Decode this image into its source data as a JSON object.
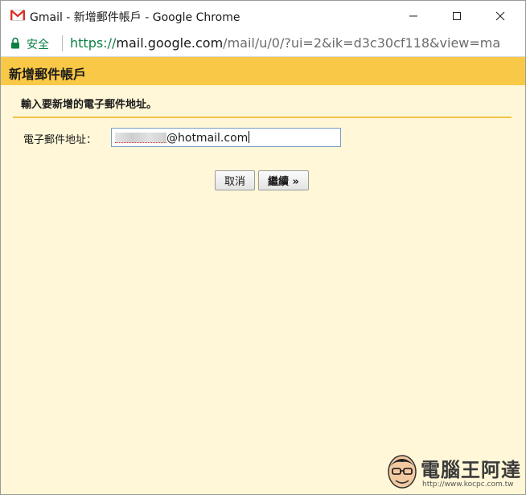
{
  "window": {
    "title": "Gmail - 新增郵件帳戶 - Google Chrome",
    "app_icon": "gmail-icon",
    "controls": [
      "minimize-icon",
      "maximize-icon",
      "close-icon"
    ]
  },
  "address_bar": {
    "security_label": "安全",
    "url_scheme": "https://",
    "url_host": "mail.google.com",
    "url_path": "/mail/u/0/?ui=2&ik=d3c30cf118&view=ma"
  },
  "dialog": {
    "header_title": "新增郵件帳戶",
    "instruction": "輸入要新增的電子郵件地址。",
    "email_label": "電子郵件地址：",
    "email_value": "@hotmail.com",
    "cancel_label": "取消",
    "continue_label": "繼續 »"
  },
  "watermark": {
    "brand": "電腦王阿達",
    "url": "http://www.kocpc.com.tw"
  },
  "colors": {
    "header_bg": "#f9c846",
    "page_bg": "#fff7d7",
    "secure_green": "#0b8043",
    "divider": "#f0c24a"
  }
}
